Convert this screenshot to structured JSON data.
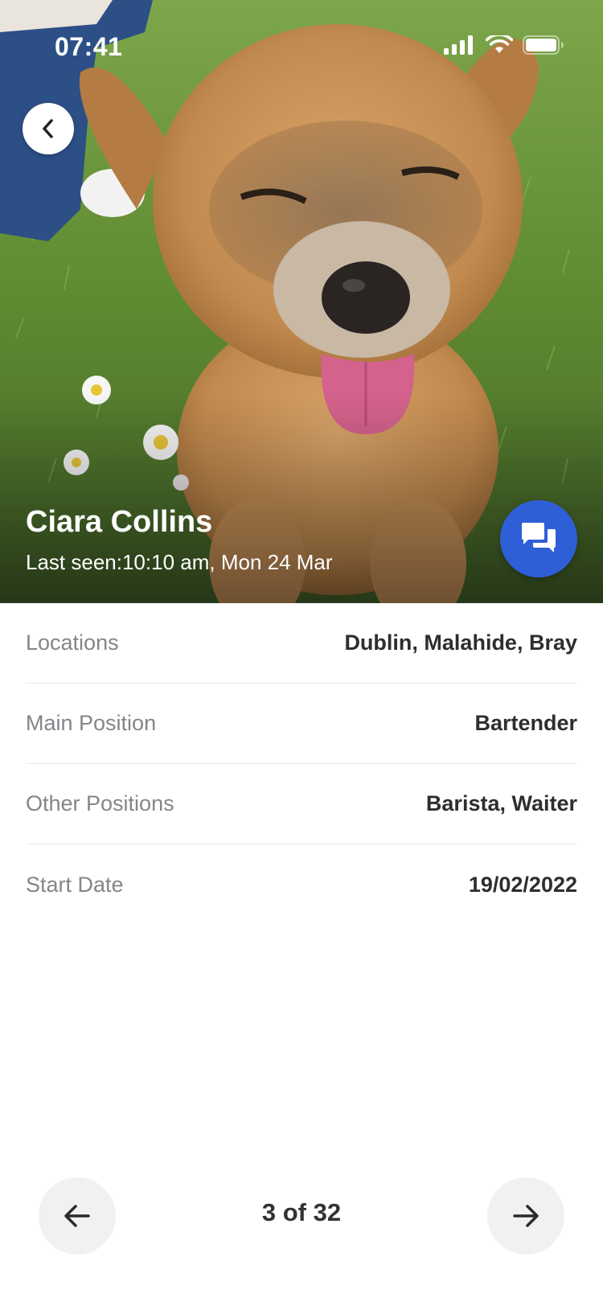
{
  "status_bar": {
    "time": "07:41",
    "icons": [
      "signal-icon",
      "wifi-icon",
      "battery-icon"
    ]
  },
  "hero": {
    "photo": "dog-photo",
    "back_icon": "chevron-left-icon",
    "chat_icon": "chat-icon"
  },
  "profile": {
    "name": "Ciara Collins",
    "last_seen": "Last seen:10:10 am, Mon 24 Mar"
  },
  "details": [
    {
      "label": "Locations",
      "value": "Dublin, Malahide, Bray"
    },
    {
      "label": "Main Position",
      "value": "Bartender"
    },
    {
      "label": "Other Positions",
      "value": "Barista, Waiter"
    },
    {
      "label": "Start Date",
      "value": "19/02/2022"
    }
  ],
  "pager": {
    "label": "3 of 32",
    "prev_icon": "arrow-left-icon",
    "next_icon": "arrow-right-icon"
  },
  "colors": {
    "accent": "#2f5fd6",
    "label_gray": "#85858a",
    "divider": "#e8e8ea",
    "pager_button_bg": "#f1f1f3"
  }
}
